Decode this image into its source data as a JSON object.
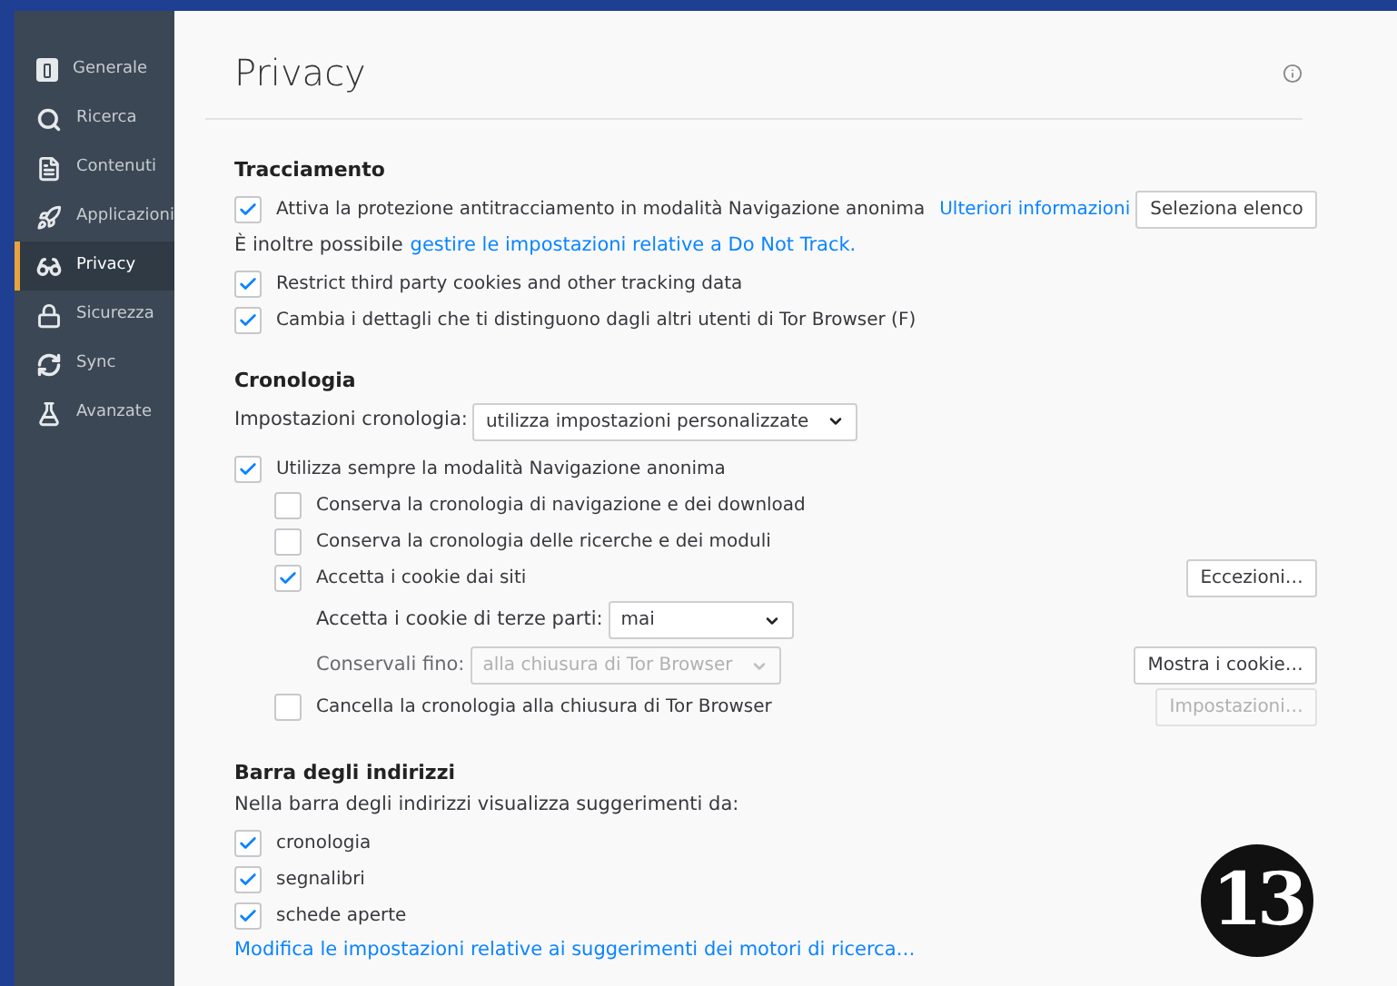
{
  "sidebar": {
    "items": [
      {
        "label": "Generale",
        "selected": false
      },
      {
        "label": "Ricerca",
        "selected": false
      },
      {
        "label": "Contenuti",
        "selected": false
      },
      {
        "label": "Applicazioni",
        "selected": false
      },
      {
        "label": "Privacy",
        "selected": true
      },
      {
        "label": "Sicurezza",
        "selected": false
      },
      {
        "label": "Sync",
        "selected": false
      },
      {
        "label": "Avanzate",
        "selected": false
      }
    ]
  },
  "page": {
    "title": "Privacy"
  },
  "tracking": {
    "heading": "Tracciamento",
    "private_protection": {
      "label": "Attiva la protezione antitracciamento in modalità Navigazione anonima",
      "checked": true,
      "link": "Ulteriori informazioni",
      "button": "Seleziona elenco"
    },
    "dnt": {
      "text": "È inoltre possibile",
      "link": "gestire le impostazioni relative a Do Not Track."
    },
    "options": [
      {
        "label": "Restrict third party cookies and other tracking data",
        "checked": true
      },
      {
        "label": "Cambia i dettagli che ti distinguono dagli altri utenti di Tor Browser (F)",
        "checked": true
      }
    ]
  },
  "history": {
    "heading": "Cronologia",
    "mode_label": "Impostazioni cronologia:",
    "mode_value": "utilizza impostazioni personalizzate",
    "always_private": {
      "label": "Utilizza sempre la modalità Navigazione anonima",
      "checked": true
    },
    "options": [
      {
        "label": "Conserva la cronologia di navigazione e dei download",
        "checked": false
      },
      {
        "label": "Conserva la cronologia delle ricerche e dei moduli",
        "checked": false
      },
      {
        "label": "Accetta i cookie dai siti",
        "checked": true,
        "button": "Eccezioni…"
      }
    ],
    "third_party": {
      "label": "Accetta i cookie di terze parti:",
      "value": "mai"
    },
    "keep_until": {
      "label": "Conservali fino:",
      "value": "alla chiusura di Tor Browser",
      "disabled": true,
      "button": "Mostra i cookie…"
    },
    "clear_on_close": {
      "label": "Cancella la cronologia alla chiusura di Tor Browser",
      "checked": false,
      "button": "Impostazioni…",
      "button_disabled": true
    }
  },
  "address_bar": {
    "heading": "Barra degli indirizzi",
    "intro": "Nella barra degli indirizzi visualizza suggerimenti da:",
    "options": [
      {
        "label": "cronologia",
        "checked": true
      },
      {
        "label": "segnalibri",
        "checked": true
      },
      {
        "label": "schede aperte",
        "checked": true
      }
    ],
    "link": "Modifica le impostazioni relative ai suggerimenti dei motori di ricerca…"
  },
  "callout": "13"
}
